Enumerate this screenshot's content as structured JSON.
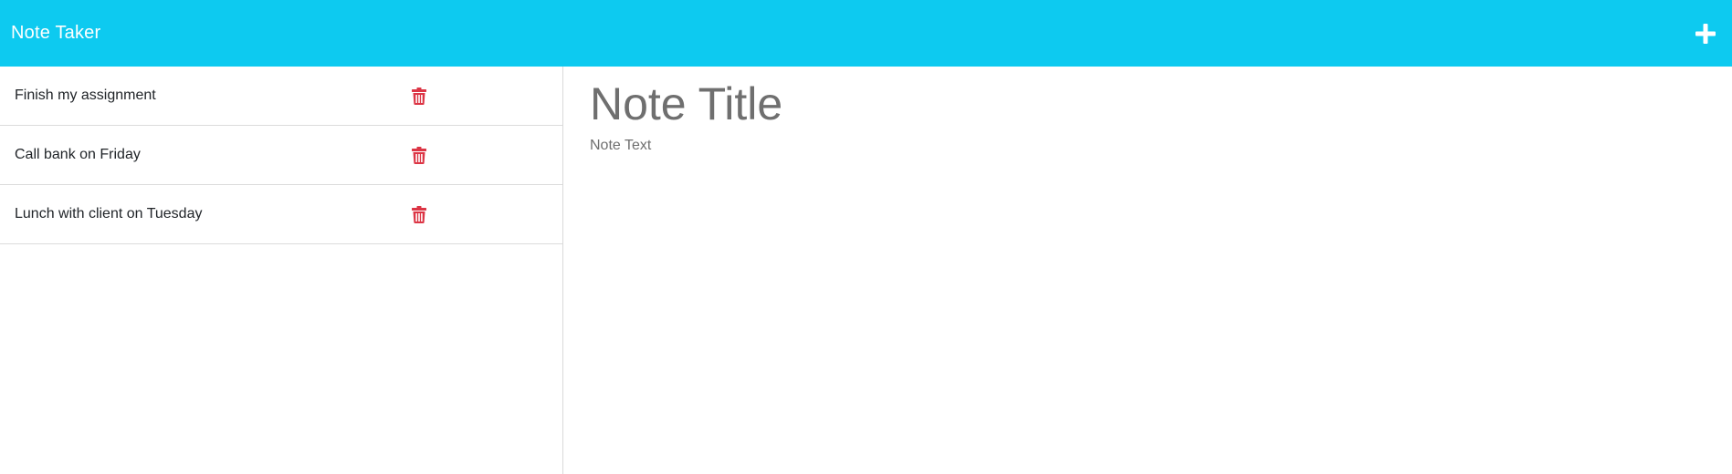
{
  "app": {
    "brand": "Note Taker",
    "accent_color": "#0dcaf0",
    "new_note_icon": "plus-icon"
  },
  "notes": [
    {
      "title": "Finish my assignment",
      "delete_icon": "trash-icon"
    },
    {
      "title": "Call bank on Friday",
      "delete_icon": "trash-icon"
    },
    {
      "title": "Lunch with client on Tuesday",
      "delete_icon": "trash-icon"
    }
  ],
  "editor": {
    "title_placeholder": "Note Title",
    "title_value": "",
    "text_placeholder": "Note Text",
    "text_value": ""
  },
  "colors": {
    "delete": "#dc3545",
    "placeholder": "#6f6f6f"
  }
}
